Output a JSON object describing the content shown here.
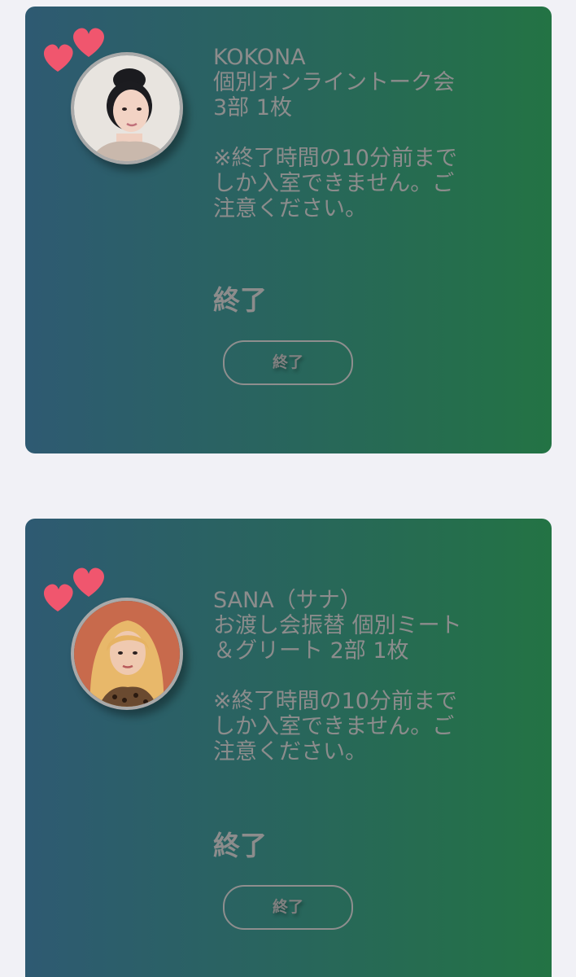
{
  "cards": [
    {
      "name": "KOKONA",
      "event_line1": "個別オンライントーク会",
      "event_line2": "3部 1枚",
      "notice_line1": "※終了時間の10分前まで",
      "notice_line2": "しか入室できません。ご",
      "notice_line3": "注意ください。",
      "status": "終了",
      "button_label": "終了",
      "avatar_icon": "idol-photo-avatar"
    },
    {
      "name": "SANA（サナ）",
      "event_line1": "お渡し会振替 個別ミート",
      "event_line2": "＆グリート 2部 1枚",
      "notice_line1": "※終了時間の10分前まで",
      "notice_line2": "しか入室できません。ご",
      "notice_line3": "注意ください。",
      "status": "終了",
      "button_label": "終了",
      "avatar_icon": "idol-photo-avatar"
    }
  ],
  "colors": {
    "page_background": "#f1f1f6",
    "card_gradient_start": "#2e5a72",
    "card_gradient_end": "#237344",
    "heart": "#f0566e",
    "text_muted": "#8c8c8c"
  }
}
